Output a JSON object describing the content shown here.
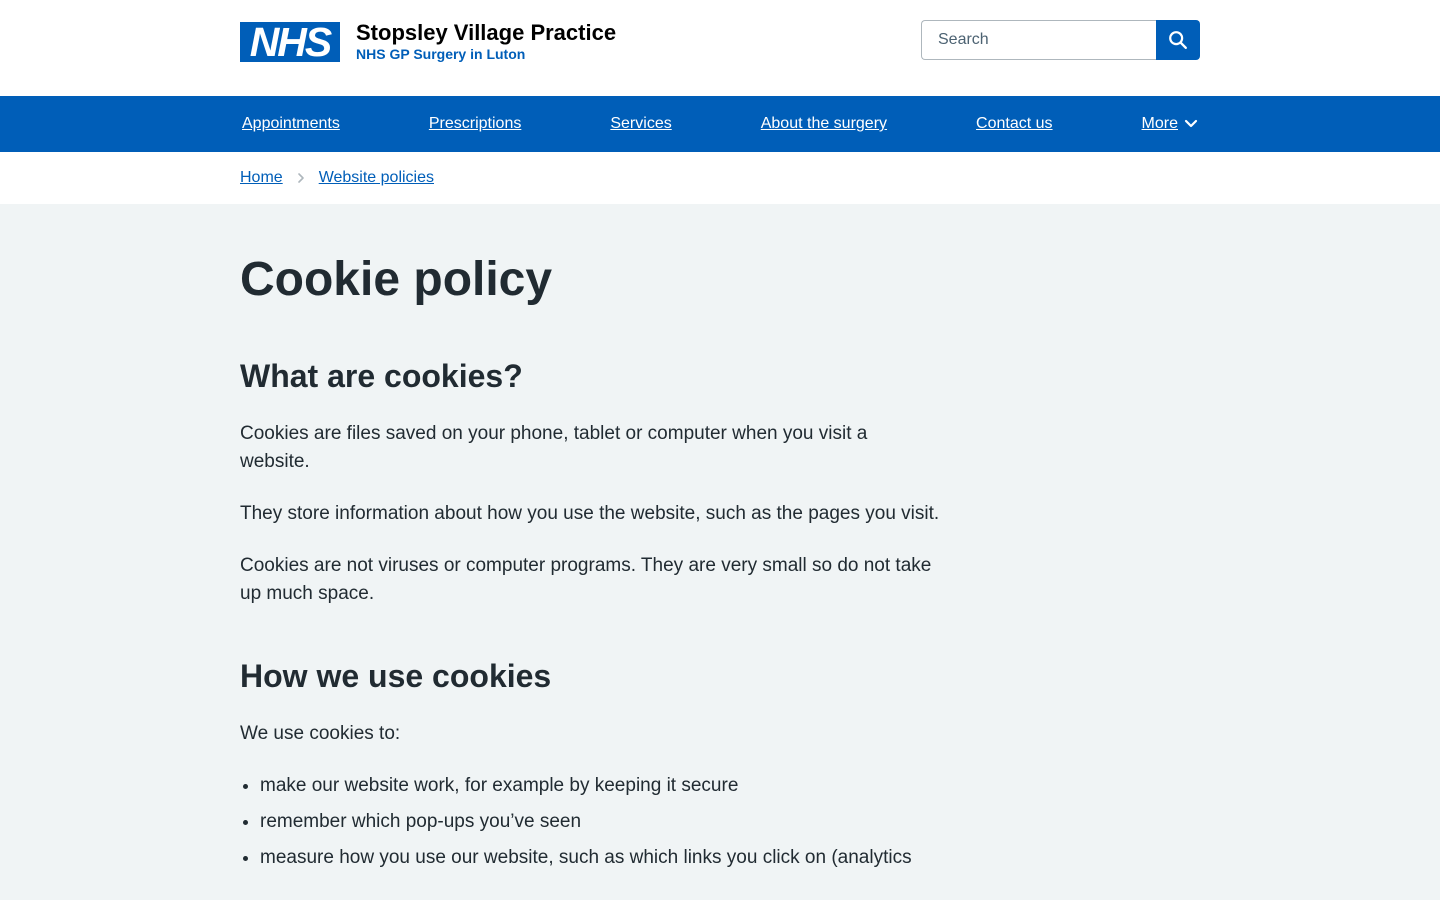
{
  "header": {
    "logo_text": "NHS",
    "org_name": "Stopsley Village Practice",
    "org_desc": "NHS GP Surgery in Luton",
    "search_placeholder": "Search"
  },
  "nav": {
    "items": [
      "Appointments",
      "Prescriptions",
      "Services",
      "About the surgery",
      "Contact us"
    ],
    "more_label": "More"
  },
  "breadcrumb": {
    "items": [
      "Home",
      "Website policies"
    ]
  },
  "page": {
    "title": "Cookie policy",
    "sections": [
      {
        "heading": "What are cookies?",
        "paragraphs": [
          "Cookies are files saved on your phone, tablet or computer when you visit a website.",
          "They store information about how you use the website, such as the pages you visit.",
          "Cookies are not viruses or computer programs. They are very small so do not take up much space."
        ]
      },
      {
        "heading": "How we use cookies",
        "intro": "We use cookies to:",
        "bullets": [
          "make our website work, for example by keeping it secure",
          "remember which pop-ups you’ve seen",
          "measure how you use our website, such as which links you click on (analytics"
        ]
      }
    ]
  },
  "colors": {
    "brand_blue": "#005eb8",
    "text": "#212b32",
    "page_bg": "#f0f4f5"
  }
}
